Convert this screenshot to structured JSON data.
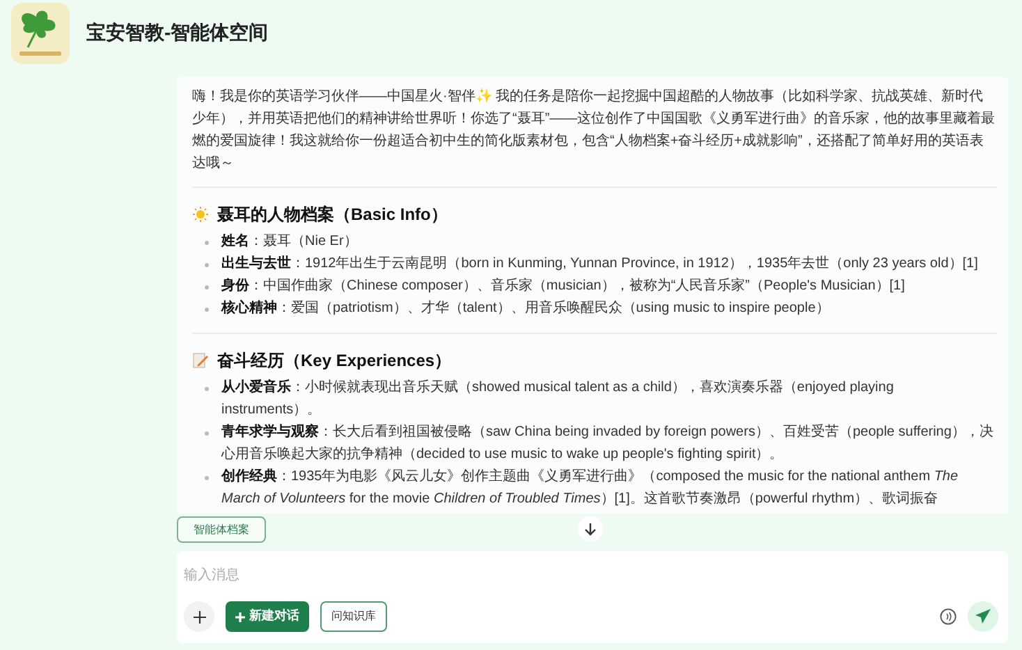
{
  "header": {
    "title": "宝安智教-智能体空间"
  },
  "chat": {
    "intro": "嗨！我是你的英语学习伙伴——中国星火·智伴✨ 我的任务是陪你一起挖掘中国超酷的人物故事（比如科学家、抗战英雄、新时代少年），并用英语把他们的精神讲给世界听！你选了“聂耳”——这位创作了中国国歌《义勇军进行曲》的音乐家，他的故事里藏着最燃的爱国旋律！我这就给你一份超适合初中生的简化版素材包，包含“人物档案+奋斗经历+成就影响”，还搭配了简单好用的英语表达哦～",
    "sections": [
      {
        "heading": "聂耳的人物档案（Basic Info）",
        "items": [
          "**姓名**：聂耳（Nie Er）",
          "**出生与去世**：1912年出生于云南昆明（born in Kunming, Yunnan Province, in 1912），1935年去世（only 23 years old）[1]",
          "**身份**：中国作曲家（Chinese composer）、音乐家（musician），被称为“人民音乐家”（People's Musician）[1]",
          "**核心精神**：爱国（patriotism）、才华（talent）、用音乐唤醒民众（using music to inspire people）"
        ]
      },
      {
        "heading": "奋斗经历（Key Experiences）",
        "items": [
          "**从小爱音乐**：小时候就表现出音乐天赋（showed musical talent as a child），喜欢演奏乐器（enjoyed playing instruments）。",
          "**青年求学与观察**：长大后看到祖国被侵略（saw China being invaded by foreign powers）、百姓受苦（people suffering），决心用音乐唤起大家的抗争精神（decided to use music to wake up people's fighting spirit）。",
          "**创作经典**：1935年为电影《风云儿女》创作主题曲《义勇军进行曲》（composed the music for the national anthem *The March of Volunteers* for the movie *Children of Troubled Times*）[1]。这首歌节奏激昂（powerful rhythm）、歌词振奋"
        ]
      }
    ]
  },
  "agent_profile_button": "智能体档案",
  "composer": {
    "placeholder": "输入消息",
    "new_chat": "新建对话",
    "knowledge": "问知识库"
  }
}
